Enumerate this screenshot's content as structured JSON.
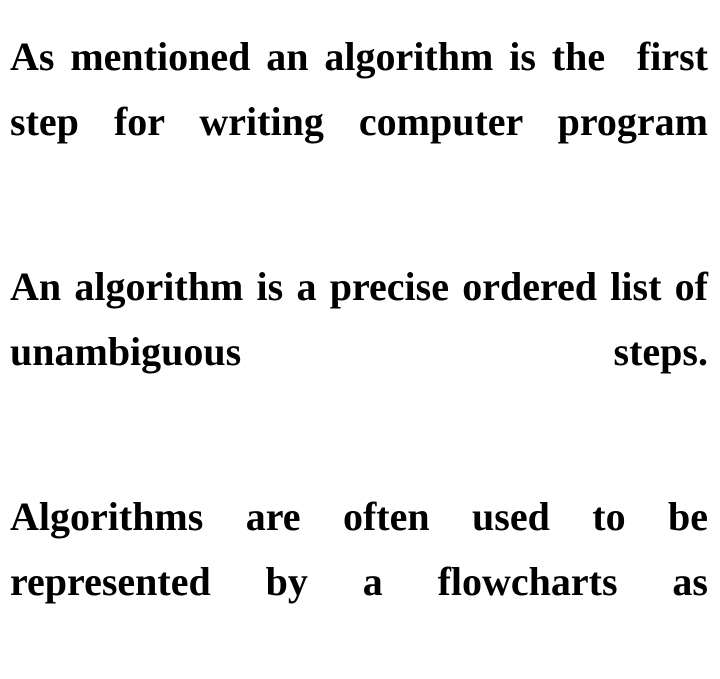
{
  "slide": {
    "background_color": "#ffffff",
    "text_color": "#000000",
    "alignment": "justify",
    "paragraphs": [
      {
        "id": "p1",
        "text": "As mentioned an algorithm is the  first step for writing computer program"
      },
      {
        "id": "p2",
        "text": "An algorithm is a precise ordered list of unambiguous steps."
      },
      {
        "id": "p3",
        "text": "Algorithms are often used to be represented by a flowcharts as"
      }
    ]
  }
}
